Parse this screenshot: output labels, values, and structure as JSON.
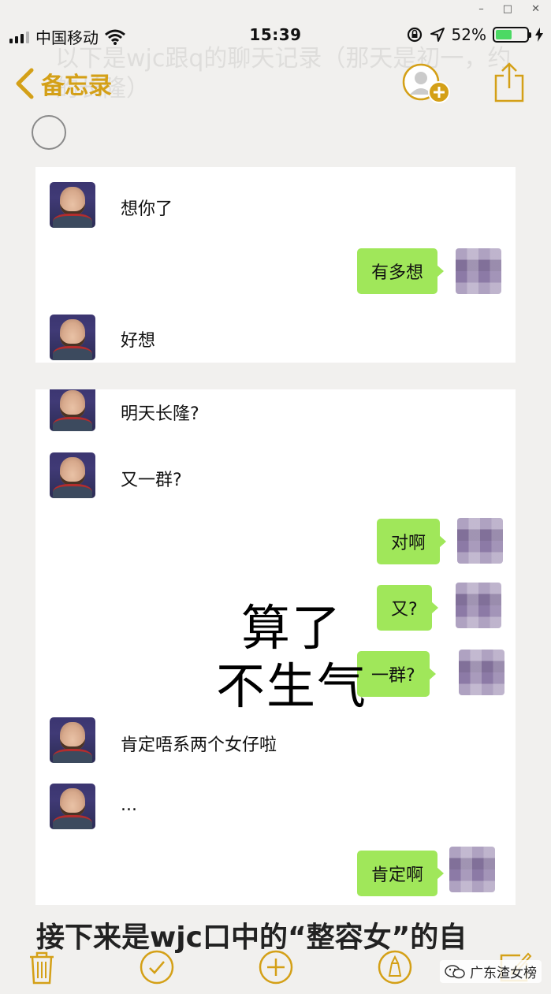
{
  "window": {
    "minimize": "–",
    "maximize": "□",
    "close": "✕"
  },
  "status_bar": {
    "carrier": "中国移动",
    "time": "15:39",
    "battery_percent": "52%",
    "battery_level": 0.52,
    "icons": [
      "signal-icon",
      "wifi-icon",
      "orientation-lock-icon",
      "location-arrow-icon",
      "battery-icon",
      "charging-bolt-icon"
    ]
  },
  "nav": {
    "back_label": "备忘录",
    "ghost_title": "以下是wjc跟q的聊天记录（那天是初一，约的长隆）"
  },
  "chat": {
    "card1": [
      {
        "side": "left",
        "text": "想你了"
      },
      {
        "side": "right",
        "text": "有多想"
      },
      {
        "side": "left",
        "text": "好想"
      }
    ],
    "card2": [
      {
        "side": "left",
        "text": "明天长隆?"
      },
      {
        "side": "left",
        "text": "又一群?"
      },
      {
        "side": "right",
        "text": "对啊"
      },
      {
        "side": "right",
        "text": "又?"
      },
      {
        "side": "right",
        "text": "一群?"
      },
      {
        "side": "left",
        "text": "肯定唔系两个女仔啦"
      },
      {
        "side": "left",
        "text": "..."
      },
      {
        "side": "right",
        "text": "肯定啊"
      }
    ]
  },
  "overlay": {
    "line1": "算了",
    "line2": "不生气"
  },
  "heading": "接下来是wjc口中的“整容女”的自",
  "toolbar": {
    "icons": [
      "trash-icon",
      "checklist-icon",
      "add-icon",
      "markup-pen-icon",
      "compose-icon"
    ]
  },
  "watermark": {
    "text": "广东渣女榜"
  },
  "colors": {
    "accent": "#d4a017",
    "bubble_green": "#a0e75a",
    "battery_green": "#4cd964"
  }
}
